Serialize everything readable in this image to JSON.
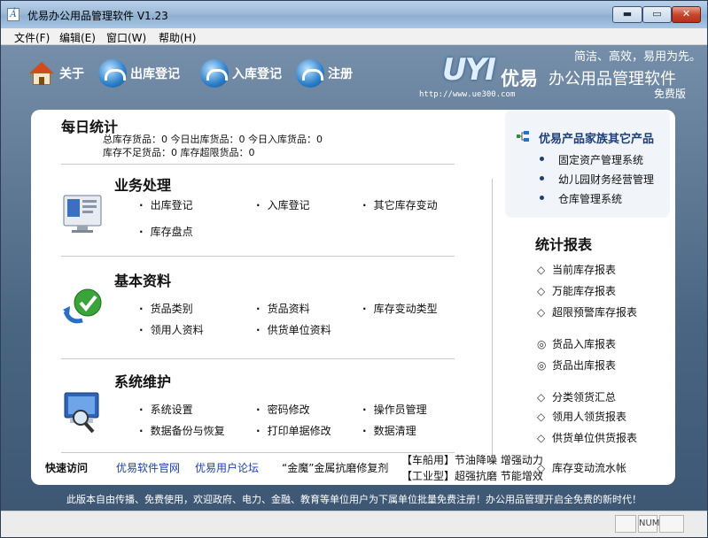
{
  "window": {
    "title": "优易办公用品管理软件 V1.23"
  },
  "menu": [
    "文件(F)",
    "编辑(E)",
    "窗口(W)",
    "帮助(H)"
  ],
  "toolbar": {
    "about": "关于",
    "outbound": "出库登记",
    "inbound": "入库登记",
    "register": "注册"
  },
  "logo": {
    "slogan": "简洁、高效，易用为先。",
    "brand": "UYI",
    "name_cn": "优易",
    "product": "办公用品管理软件",
    "url": "http://www.ue300.com",
    "edition": "免费版"
  },
  "daily": {
    "title": "每日统计",
    "line1": "总库存货品：0   今日出库货品：0   今日入库货品：0",
    "line2": "库存不足货品：0   库存超限货品：0"
  },
  "business": {
    "title": "业务处理",
    "links": [
      "出库登记",
      "入库登记",
      "其它库存变动",
      "库存盘点"
    ]
  },
  "basic": {
    "title": "基本资料",
    "links": [
      "货品类别",
      "货品资料",
      "库存变动类型",
      "领用人资料",
      "供货单位资料"
    ]
  },
  "system": {
    "title": "系统维护",
    "links": [
      "系统设置",
      "密码修改",
      "操作员管理",
      "数据备份与恢复",
      "打印单据修改",
      "数据清理"
    ]
  },
  "family": {
    "title": "优易产品家族其它产品",
    "items": [
      "固定资产管理系统",
      "幼儿园财务经营管理",
      "仓库管理系统"
    ]
  },
  "reports": {
    "title": "统计报表",
    "items": [
      {
        "mark": "◇",
        "label": "当前库存报表"
      },
      {
        "mark": "◇",
        "label": "万能库存报表"
      },
      {
        "mark": "◇",
        "label": "超限预警库存报表"
      },
      {
        "mark": "◎",
        "label": "货品入库报表"
      },
      {
        "mark": "◎",
        "label": "货品出库报表"
      },
      {
        "mark": "◇",
        "label": "分类领货汇总"
      },
      {
        "mark": "◇",
        "label": "领用人领货报表"
      },
      {
        "mark": "◇",
        "label": "供货单位供货报表"
      },
      {
        "mark": "◇",
        "label": "库存变动流水帐"
      }
    ]
  },
  "quick": {
    "label": "快速访问",
    "official": "优易软件官网",
    "forum": "优易用户论坛",
    "ad1": "“金魔”金属抗磨修复剂",
    "ad2": "【车船用】节油降噪  增强动力",
    "ad3": "【工业型】超强抗磨  节能增效"
  },
  "notice": "此版本自由传播、免费使用，欢迎政府、电力、金融、教育等单位用户为下属单位批量免费注册！办公用品管理开启全免费的新时代！",
  "status": {
    "num": "NUM"
  }
}
